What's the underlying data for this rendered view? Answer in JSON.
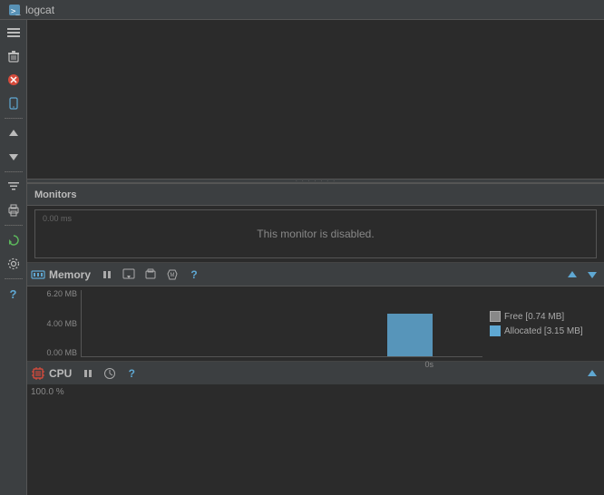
{
  "tab": {
    "label": "logcat",
    "icon": "logcat-icon"
  },
  "toolbar": {
    "buttons": [
      {
        "id": "menu",
        "icon": "≡",
        "color": "normal"
      },
      {
        "id": "trash",
        "icon": "🗑",
        "color": "normal"
      },
      {
        "id": "stop",
        "icon": "✕",
        "color": "red"
      },
      {
        "id": "devices",
        "icon": "📱",
        "color": "blue"
      },
      {
        "id": "up",
        "icon": "▲",
        "color": "normal"
      },
      {
        "id": "down",
        "icon": "▼",
        "color": "normal"
      },
      {
        "id": "filter",
        "icon": "▤",
        "color": "normal"
      },
      {
        "id": "print",
        "icon": "🖨",
        "color": "normal"
      },
      {
        "id": "refresh",
        "icon": "↻",
        "color": "green"
      },
      {
        "id": "settings",
        "icon": "⚙",
        "color": "normal"
      },
      {
        "id": "help",
        "icon": "?",
        "color": "blue"
      }
    ]
  },
  "monitors": {
    "header": "Monitors",
    "disabled_text": "This monitor is disabled.",
    "disabled_y_label": "0.00 ms"
  },
  "memory_monitor": {
    "title": "Memory",
    "title_icon": "memory-icon",
    "y_labels": [
      "6.20 MB",
      "4.00 MB",
      "0.00 MB"
    ],
    "x_label": "0s",
    "legend": {
      "free_label": "Free [0.74 MB]",
      "allocated_label": "Allocated [3.15 MB]"
    },
    "bar_height_percent": 65,
    "buttons": {
      "pause": "⏸",
      "camera": "📷",
      "bar_chart": "📊",
      "dump": "⬇",
      "help": "?",
      "arrow_up": "▲",
      "arrow_down": "▼"
    }
  },
  "cpu_monitor": {
    "title": "CPU",
    "title_icon": "cpu-icon",
    "percentage_label": "100.0 %",
    "buttons": {
      "pause": "⏸",
      "clock": "⏱",
      "help": "?",
      "arrow_up": "▲"
    }
  }
}
